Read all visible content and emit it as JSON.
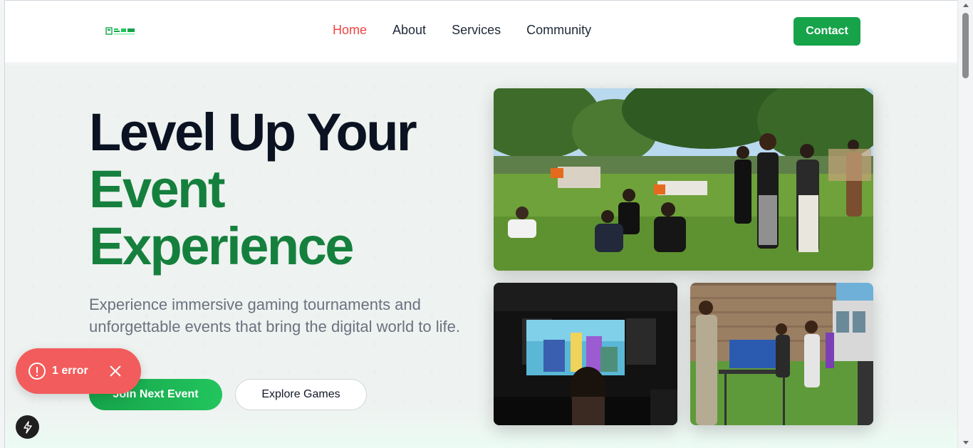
{
  "header": {
    "logo_alt": "logo",
    "nav": [
      {
        "label": "Home",
        "active": true
      },
      {
        "label": "About",
        "active": false
      },
      {
        "label": "Services",
        "active": false
      },
      {
        "label": "Community",
        "active": false
      }
    ],
    "contact_label": "Contact"
  },
  "hero": {
    "title_line1": "Level Up Your",
    "title_line2": "Event",
    "title_line3": "Experience",
    "subtitle": "Experience immersive gaming tournaments and unforgettable events that bring the digital world to life.",
    "primary_button": "Join Next Event",
    "secondary_button": "Explore Games"
  },
  "toast": {
    "error_text": "1 error"
  },
  "colors": {
    "accent_green": "#16a34a",
    "title_green": "#15803d",
    "nav_active": "#ef4444",
    "error_red": "#f25c5c"
  },
  "icons": [
    "error-icon",
    "close-icon",
    "bolt-icon"
  ]
}
